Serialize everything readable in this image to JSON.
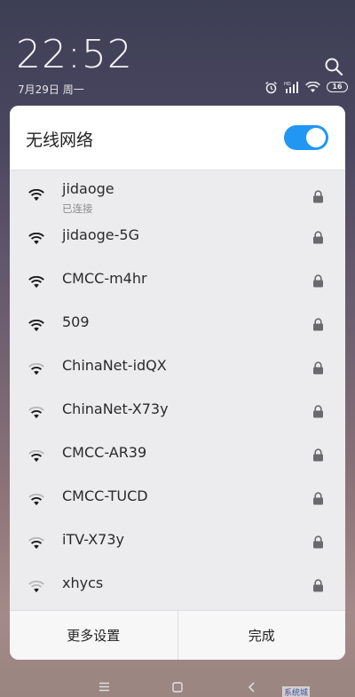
{
  "status": {
    "time": "22:52",
    "date": "7月29日 周一",
    "battery": "16",
    "signal_label": "HD"
  },
  "panel": {
    "title": "无线网络",
    "toggle_on": true,
    "networks": [
      {
        "ssid": "jidaoge",
        "status": "已连接",
        "signal": 4,
        "locked": true
      },
      {
        "ssid": "jidaoge-5G",
        "signal": 4,
        "locked": true
      },
      {
        "ssid": "CMCC-m4hr",
        "signal": 4,
        "locked": true
      },
      {
        "ssid": "509",
        "signal": 3,
        "locked": true
      },
      {
        "ssid": "ChinaNet-idQX",
        "signal": 2,
        "locked": true
      },
      {
        "ssid": "ChinaNet-X73y",
        "signal": 2,
        "locked": true
      },
      {
        "ssid": "CMCC-AR39",
        "signal": 2,
        "locked": true
      },
      {
        "ssid": "CMCC-TUCD",
        "signal": 2,
        "locked": true
      },
      {
        "ssid": "iTV-X73y",
        "signal": 2,
        "locked": true
      },
      {
        "ssid": "xhycs",
        "signal": 1,
        "locked": true
      }
    ],
    "footer": {
      "more_settings": "更多设置",
      "done": "完成"
    }
  },
  "colors": {
    "accent": "#2196f3",
    "panel_bg": "#ececee"
  },
  "watermark": "系统城"
}
